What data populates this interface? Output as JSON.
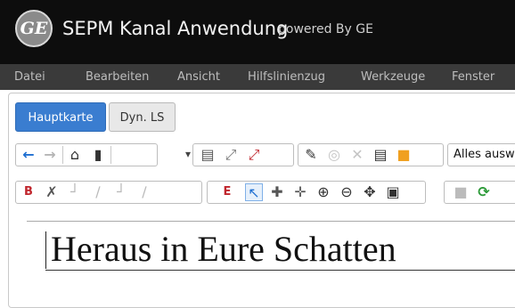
{
  "window": {
    "logo_text": "GE",
    "title": "SEPM Kanal Anwendung",
    "powered_by": "powered By GE"
  },
  "menu": {
    "items": [
      "Datei",
      "Bearbeiten",
      "Ansicht",
      "Hilfslinienzug",
      "Werkzeuge",
      "Fenster"
    ]
  },
  "tabs": [
    {
      "label": "Hauptkarte",
      "active": true
    },
    {
      "label": "Dyn. LS",
      "active": false
    }
  ],
  "toolbar1": {
    "select_value": "Alles ausw"
  },
  "editor": {
    "heading": "Heraus in Eure Schatten"
  },
  "colors": {
    "titlebar": "#0d0d0d",
    "menubar": "#3a3a3a",
    "accent": "#3a7dd0",
    "arrow": "#1f6fd1",
    "folder": "#f0a020",
    "marker_red": "#c0262d",
    "refresh_green": "#2e9b3a"
  }
}
